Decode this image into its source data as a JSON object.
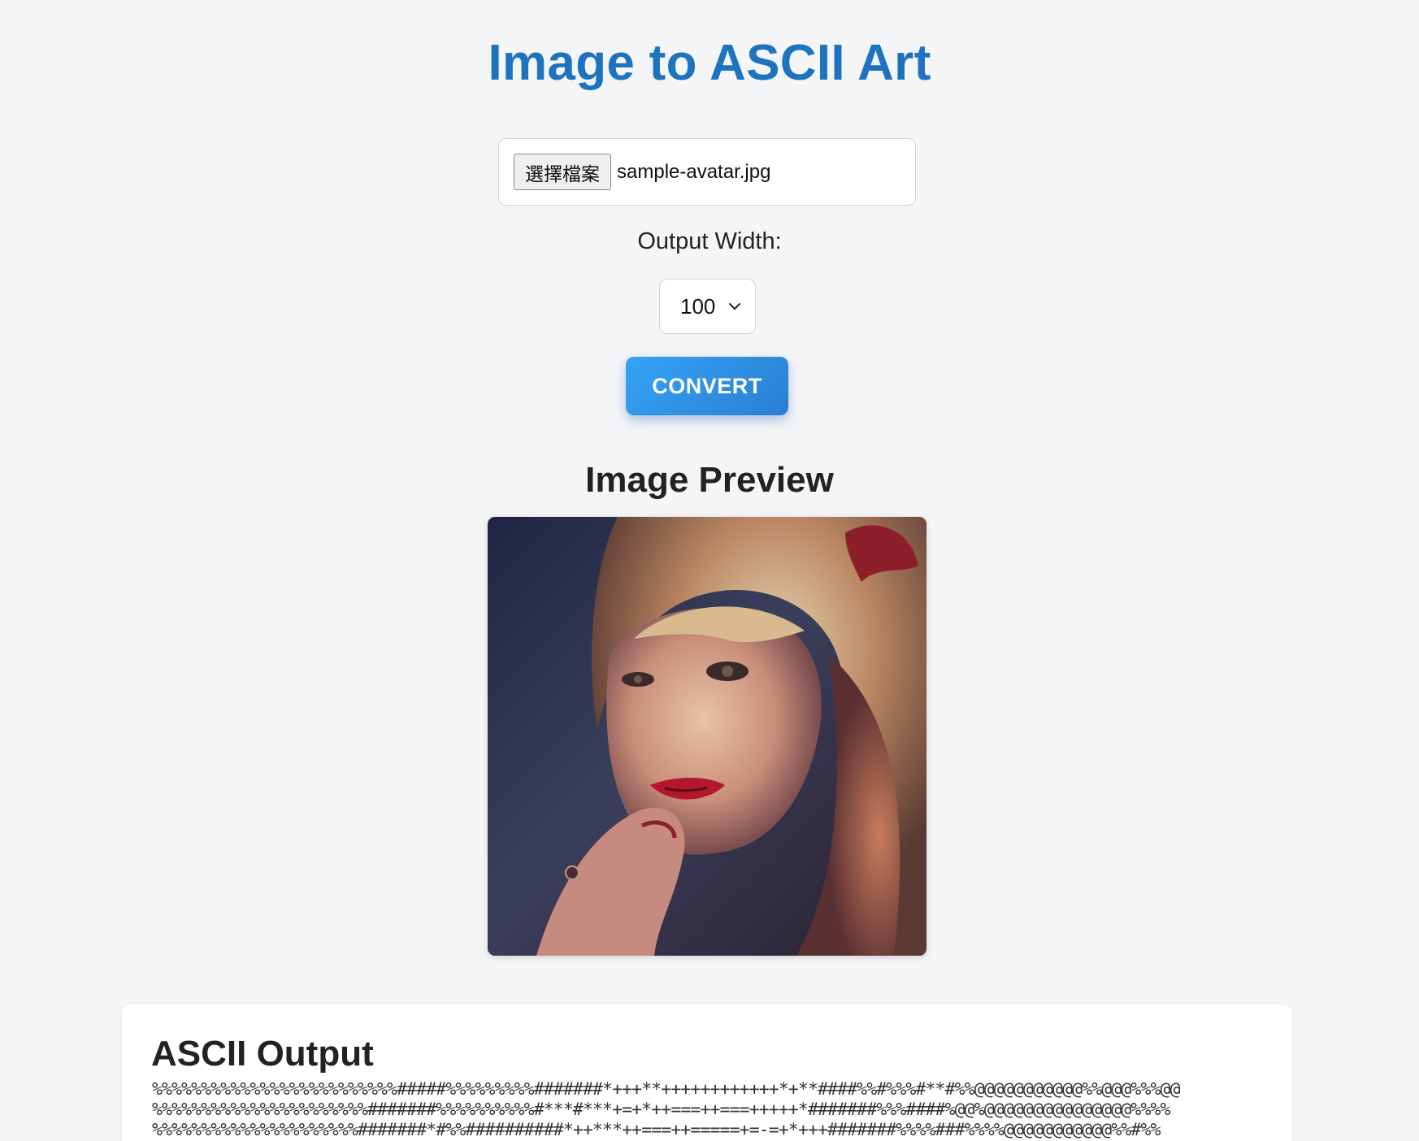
{
  "header": {
    "title": "Image to ASCII Art"
  },
  "file_input": {
    "button_label": "選擇檔案",
    "file_name": "sample-avatar.jpg"
  },
  "width_control": {
    "label": "Output Width:",
    "selected_value": "100"
  },
  "convert_button": {
    "label": "CONVERT"
  },
  "preview": {
    "heading": "Image Preview",
    "image_alt": "portrait photo"
  },
  "output": {
    "heading": "ASCII Output",
    "lines": [
      "%%%%%%%%%%%%%%%%%%%%%%%%%#####%%%%%%%%%#######*+++**++++++++++++*+**####%%#%%%#**#%%@@@@@@@@@@@%%@@@%%%@@",
      "%%%%%%%%%%%%%%%%%%%%%%#######%%%%%%%%%%#***#***+=+*++===++===+++++*#######%%%####%@@%@@@@@@@@@@@@@@@%%%%",
      "%%%%%%%%%%%%%%%%%%%%%#######*#%%##########*++***++===++=====+=-=+*+++#######%%%%###%%%%@@@@@@@@@@@%%#%%"
    ]
  },
  "colors": {
    "accent": "#1e73be",
    "button_gradient_start": "#35a3f5",
    "button_gradient_end": "#2a7fd2",
    "background": "#f4f5f7"
  }
}
